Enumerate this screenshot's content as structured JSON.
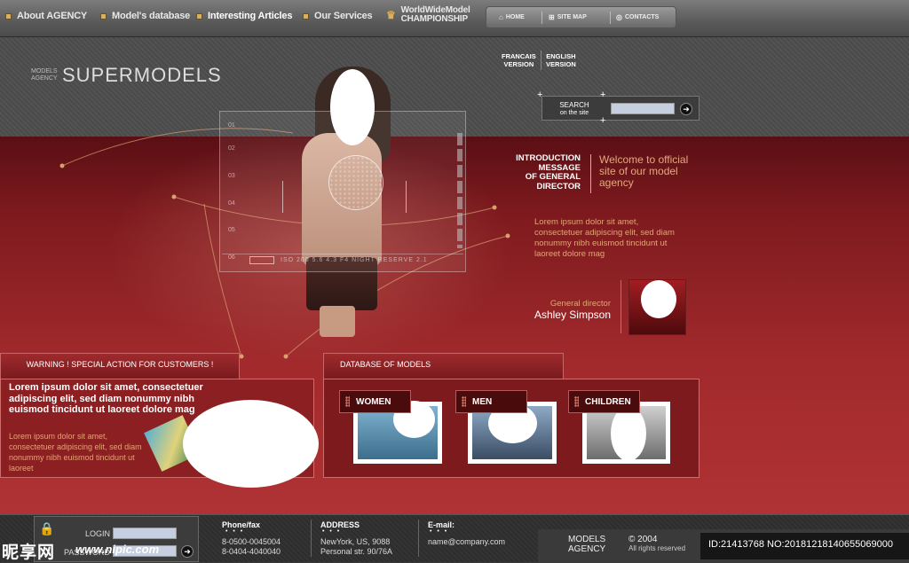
{
  "nav": {
    "items": [
      "About AGENCY",
      "Model's database",
      "Interesting Articles",
      "Our Services"
    ],
    "championship_line1": "WorldWideModel",
    "championship_line2": "CHAMPIONSHIP",
    "util": {
      "home": "HOME",
      "sitemap": "SITE MAP",
      "contacts": "CONTACTS"
    }
  },
  "lang": {
    "fr_line1": "FRANCAIS",
    "fr_line2": "VERSION",
    "en_line1": "ENGLISH",
    "en_line2": "VERSION"
  },
  "logo": {
    "small_line1": "MODELS",
    "small_line2": "AGENCY",
    "big": "SUPERMODELS"
  },
  "search": {
    "label_line1": "SEARCH",
    "label_line2": "on the site",
    "value": ""
  },
  "hud": {
    "numbers": [
      "01",
      "02",
      "03",
      "04",
      "05",
      "06"
    ],
    "caption": "ISO 200   5.6   4.3 F4              NIGHT RESERVE 2.1"
  },
  "intro": {
    "title_line1": "INTRODUCTION",
    "title_line2": "MESSAGE",
    "title_line3": "OF GENERAL",
    "title_line4": "DIRECTOR",
    "welcome_line1": "Welcome to official",
    "welcome_line2": "site of our model",
    "welcome_line3": "agency",
    "body": "Lorem ipsum dolor sit amet, consectetuer adipiscing elit, sed diam nonummy nibh euismod tincidunt ut laoreet dolore mag"
  },
  "director": {
    "role": "General director",
    "name": "Ashley Simpson"
  },
  "warning": {
    "tab": "WARNING !  SPECIAL ACTION FOR CUSTOMERS !",
    "headline": "Lorem ipsum dolor sit amet, consectetuer adipiscing elit, sed diam nonummy nibh euismod tincidunt ut laoreet dolore mag",
    "body": "Lorem ipsum dolor sit amet, consectetuer adipiscing elit, sed diam nonummy nibh euismod tincidunt ut laoreet"
  },
  "database": {
    "tab": "DATABASE OF MODELS",
    "categories": [
      "WOMEN",
      "MEN",
      "CHILDREN"
    ]
  },
  "footer": {
    "login_label": "LOGIN",
    "password_label": "PASSWORD",
    "phone_title": "Phone/fax",
    "phone1": "8-0500-0045004",
    "phone2": "8-0404-4040040",
    "address_title": "ADDRESS",
    "address1": "NewYork, US, 9088",
    "address2": "Personal str. 90/76A",
    "email_title": "E-mail:",
    "email": "name@company.com",
    "dots": "• • •",
    "logo_line1": "MODELS",
    "logo_line2": "AGENCY",
    "copy_year": "© 2004",
    "copy_rights": "All rights reserved",
    "image_id": "ID:21413768 NO:20181218140655069000"
  },
  "watermark": {
    "cn": "昵享网",
    "url": "www.nipic.com"
  },
  "colors": {
    "red_dark": "#5a0f14",
    "red": "#a22a2c",
    "accent": "#e6a37a",
    "gold": "#d8b060"
  }
}
